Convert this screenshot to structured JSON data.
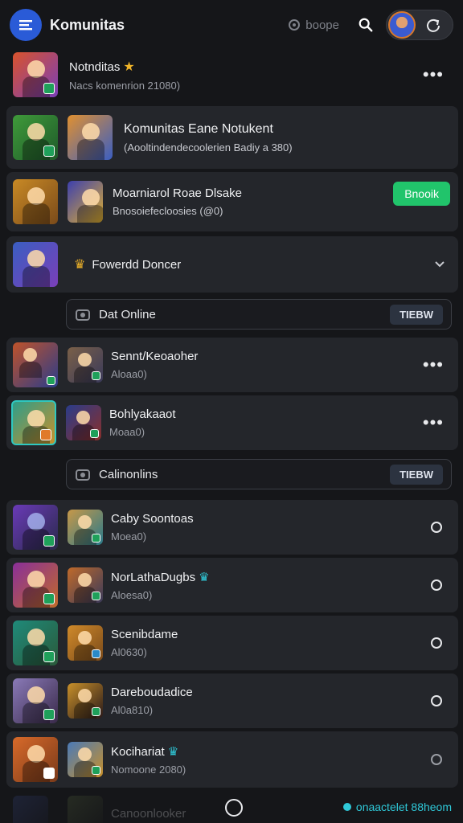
{
  "header": {
    "title": "Komunitas",
    "search_label": "boope",
    "logo_icon": "list-icon",
    "search_icon": "search-icon",
    "toggle_icon": "refresh-icon"
  },
  "rows": [
    {
      "name": "Notnditas",
      "sub": "Nacs komenrion 21080)",
      "colors": [
        "#d9532c",
        "#7a3fb8"
      ]
    },
    {
      "name": "Komunitas Eane Notukent",
      "sub": "(Aooltindendecoolerien Badiy a 380)",
      "colors": [
        "#3f9a3a",
        "#e09030"
      ]
    },
    {
      "name": "Moarniarol Roae Dlsake",
      "sub": "Bnosoiefecloosies (@0)",
      "action": "Bnooik",
      "colors": [
        "#c98a25",
        "#3c3fae"
      ]
    },
    {
      "name": "Fowerdd Doncer",
      "colors": [
        "#3a5ec2"
      ]
    },
    {
      "name": "Sennt/Keoaoher",
      "sub": "Aloaa0)",
      "colors": [
        "#c0532a",
        "#7a6048"
      ]
    },
    {
      "name": "Bohlyakaaot",
      "sub": "Moaa0)",
      "colors": [
        "#2e9e8a",
        "#2a3c8a"
      ]
    },
    {
      "name": "Caby Soontoas",
      "sub": "Moea0)",
      "colors": [
        "#6a3ab8",
        "#c79848"
      ]
    },
    {
      "name": "NorLathaDugbs",
      "sub": "Aloesa0)",
      "colors": [
        "#8a2f9a",
        "#c06a2a"
      ]
    },
    {
      "name": "Scenibdame",
      "sub": "Al0630)",
      "colors": [
        "#1f8a7a",
        "#d08a2a"
      ]
    },
    {
      "name": "Dareboudadice",
      "sub": "Al0a810)",
      "colors": [
        "#8a7ab8",
        "#c8902a"
      ]
    },
    {
      "name": "Kocihariat",
      "sub": "Nomoone 2080)",
      "colors": [
        "#d86a2a",
        "#4a7ab8"
      ]
    },
    {
      "name": "Canoonlooker",
      "colors": [
        "#3a4a8a",
        "#5a6a40"
      ]
    }
  ],
  "sections": [
    {
      "label": "Dat Online",
      "button": "TIEBW",
      "icon": "camera-icon"
    },
    {
      "label": "Calinonlins",
      "button": "TIEBW",
      "icon": "camera-icon"
    }
  ],
  "bottom": {
    "status": "onaactelet 88heom",
    "home_icon": "circle-icon"
  }
}
